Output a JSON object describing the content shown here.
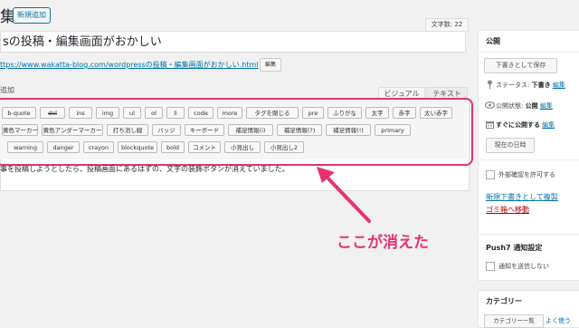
{
  "header": {
    "title_fragment": "集",
    "new_button": "新規追加",
    "word_count": "文字数: 22"
  },
  "post": {
    "title": "sの投稿・編集画面がおかしい",
    "permalink": "ttps://www.wakatta-blog.com/wordpressの投稿・編集画面がおかしい.html",
    "edit_button": "編集",
    "media_fragment": "追加",
    "tab_visual": "ビジュアル",
    "tab_text": "テキスト",
    "body_text": "事を投稿しようとしたら、投稿画面にあるはずの、文字の装飾ボタンが消えていました。"
  },
  "toolbar": {
    "row1": [
      "b-quote",
      "del",
      "ins",
      "img",
      "ul",
      "ol",
      "li",
      "code",
      "more",
      "タグを閉じる",
      "pre",
      "ふりがな",
      "太字",
      "赤字",
      "太い赤字"
    ],
    "row2": [
      "黄色マーカー",
      "黄色アンダーマーカー",
      "打ち消し線",
      "バッジ",
      "キーボード",
      "補足情報(i)",
      "補足情報(?)",
      "補足情報(!)",
      "primary"
    ],
    "row3": [
      "warning",
      "danger",
      "crayon",
      "blockquote",
      "bold",
      "コメント",
      "小見出し",
      "小見出し2"
    ]
  },
  "annotation": {
    "text": "ここが消えた",
    "color": "#e6336f"
  },
  "publish": {
    "title": "公開",
    "save_draft": "下書きとして保存",
    "status_label": "ステータス:",
    "status_value": "下書き",
    "status_edit": "編集",
    "visibility_label": "公開状態:",
    "visibility_value": "公開",
    "visibility_edit": "編集",
    "schedule_label": "すぐに公開する",
    "schedule_edit": "編集",
    "now_button": "現在の日時",
    "external_confirm": "外部確認を許可する",
    "copy_draft": "新規下書きとして複製",
    "trash": "ゴミ箱へ移動"
  },
  "push7": {
    "title": "Push7 通知設定",
    "send_notification": "通知を送信しない"
  },
  "category": {
    "title": "カテゴリー",
    "tab_all": "カテゴリー一覧",
    "tab_popular": "よく使う"
  },
  "icons": {
    "status": "pin-icon",
    "visibility": "eye-icon",
    "schedule": "calendar-icon"
  }
}
